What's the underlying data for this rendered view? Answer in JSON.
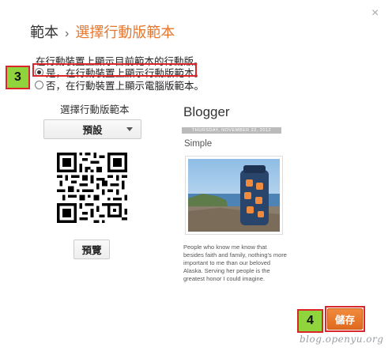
{
  "header": {
    "root": "範本",
    "separator": "›",
    "current": "選擇行動版範本",
    "close_icon": "×"
  },
  "mobile_setting": {
    "description": "在行動裝置上顯示目前範本的行動版。",
    "option_yes": "是，在行動裝置上顯示行動版範本。",
    "option_no": "否，在行動裝置上顯示電腦版範本。",
    "selected": "yes"
  },
  "template_picker": {
    "label": "選擇行動版範本",
    "selected_value": "預設"
  },
  "preview_button": "預覽",
  "preview": {
    "blog_title": "Blogger",
    "date_bar": "THURSDAY, NOVEMBER 22, 2012",
    "post_title": "Simple",
    "body_text": "People who know me know that besides faith and family, nothing's more important to me than our beloved Alaska. Serving her people is the greatest honor I could imagine."
  },
  "save_button": "儲存",
  "annotations": {
    "step3": "3",
    "step4": "4"
  },
  "watermark": "blog.openyu.org",
  "colors": {
    "accent_orange": "#e8772e",
    "highlight_red": "#d9262b",
    "step_green": "#8fd43d"
  }
}
